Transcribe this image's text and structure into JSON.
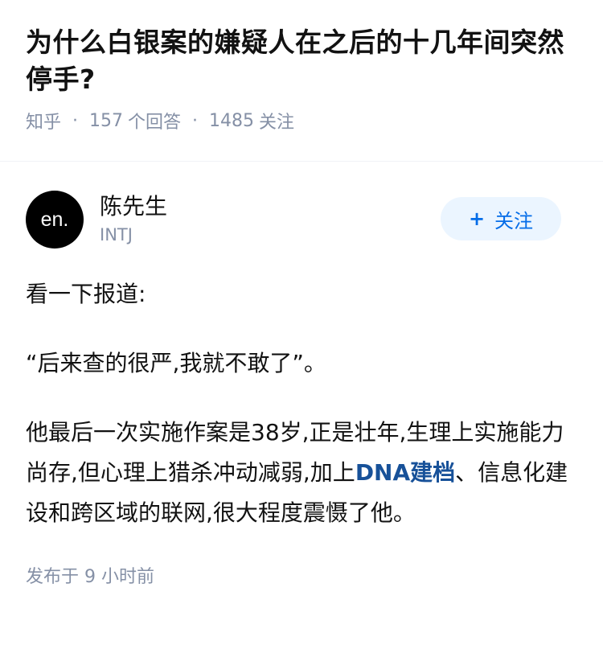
{
  "question": {
    "title": "为什么白银案的嫌疑人在之后的十几年间突然停手?",
    "source": "知乎",
    "answer_count": "157",
    "answer_label": "个回答",
    "follower_count": "1485",
    "follower_label": "关注"
  },
  "author": {
    "avatar_text": "en.",
    "name": "陈先生",
    "bio": "INTJ",
    "follow_label": "关注",
    "follow_icon": "+"
  },
  "answer": {
    "paragraph_1": "看一下报道:",
    "paragraph_2": "“后来查的很严,我就不敢了”。",
    "paragraph_3_before": "他最后一次实施作案是38岁,正是壮年,生理上实施能力尚存,但心理上猎杀冲动减弱,加上",
    "paragraph_3_link": "DNA建档",
    "paragraph_3_after": "、信息化建设和跨区域的联网,很大程度震慑了他。",
    "publish_label": "发布于",
    "publish_time": "9 小时前"
  },
  "colors": {
    "accent": "#056de8",
    "link": "#175199",
    "meta": "#8590a6",
    "follow_bg": "#ebf5ff"
  }
}
